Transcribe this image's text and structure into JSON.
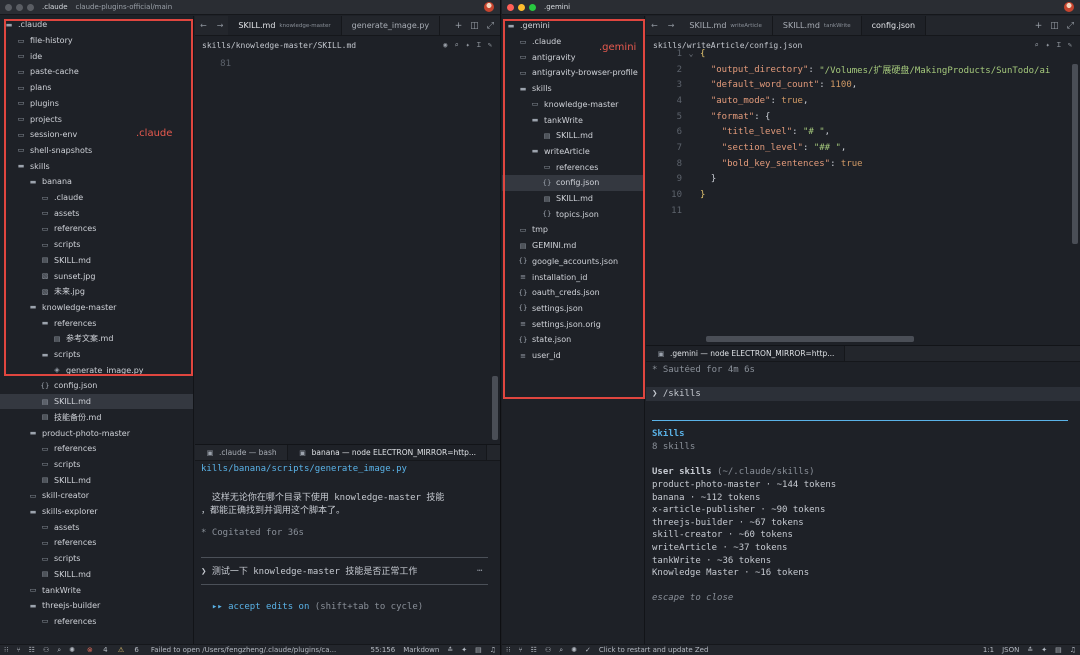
{
  "left": {
    "title": ".claude",
    "subtitle": "claude-plugins-official/main",
    "annotation_label": ".claude",
    "tree": [
      {
        "label": ".claude",
        "icon": "folder-open-icon",
        "indent": 0
      },
      {
        "label": "file-history",
        "icon": "folder-icon",
        "indent": 1
      },
      {
        "label": "ide",
        "icon": "folder-icon",
        "indent": 1
      },
      {
        "label": "paste-cache",
        "icon": "folder-icon",
        "indent": 1
      },
      {
        "label": "plans",
        "icon": "folder-icon",
        "indent": 1
      },
      {
        "label": "plugins",
        "icon": "folder-icon",
        "indent": 1
      },
      {
        "label": "projects",
        "icon": "folder-icon",
        "indent": 1
      },
      {
        "label": "session-env",
        "icon": "folder-icon",
        "indent": 1
      },
      {
        "label": "shell-snapshots",
        "icon": "folder-icon",
        "indent": 1
      },
      {
        "label": "skills",
        "icon": "folder-open-icon",
        "indent": 1
      },
      {
        "label": "banana",
        "icon": "folder-open-icon",
        "indent": 2
      },
      {
        "label": ".claude",
        "icon": "folder-icon",
        "indent": 3
      },
      {
        "label": "assets",
        "icon": "folder-icon",
        "indent": 3
      },
      {
        "label": "references",
        "icon": "folder-icon",
        "indent": 3
      },
      {
        "label": "scripts",
        "icon": "folder-icon",
        "indent": 3
      },
      {
        "label": "SKILL.md",
        "icon": "markdown-file-icon",
        "indent": 3
      },
      {
        "label": "sunset.jpg",
        "icon": "image-file-icon",
        "indent": 3
      },
      {
        "label": "未来.jpg",
        "icon": "image-file-icon",
        "indent": 3
      },
      {
        "label": "knowledge-master",
        "icon": "folder-open-icon",
        "indent": 2
      },
      {
        "label": "references",
        "icon": "folder-open-icon",
        "indent": 3
      },
      {
        "label": "参考文案.md",
        "icon": "markdown-file-icon",
        "indent": 4
      },
      {
        "label": "scripts",
        "icon": "folder-open-icon",
        "indent": 3
      },
      {
        "label": "generate_image.py",
        "icon": "python-file-icon",
        "indent": 4
      },
      {
        "label": "config.json",
        "icon": "json-file-icon",
        "indent": 3
      },
      {
        "label": "SKILL.md",
        "icon": "markdown-file-icon",
        "indent": 3,
        "selected": true
      },
      {
        "label": "技能备份.md",
        "icon": "markdown-file-icon",
        "indent": 3
      },
      {
        "label": "product-photo-master",
        "icon": "folder-open-icon",
        "indent": 2
      },
      {
        "label": "references",
        "icon": "folder-icon",
        "indent": 3
      },
      {
        "label": "scripts",
        "icon": "folder-icon",
        "indent": 3
      },
      {
        "label": "SKILL.md",
        "icon": "markdown-file-icon",
        "indent": 3
      },
      {
        "label": "skill-creator",
        "icon": "folder-icon",
        "indent": 2
      },
      {
        "label": "skills-explorer",
        "icon": "folder-open-icon",
        "indent": 2
      },
      {
        "label": "assets",
        "icon": "folder-icon",
        "indent": 3
      },
      {
        "label": "references",
        "icon": "folder-icon",
        "indent": 3
      },
      {
        "label": "scripts",
        "icon": "folder-icon",
        "indent": 3
      },
      {
        "label": "SKILL.md",
        "icon": "markdown-file-icon",
        "indent": 3
      },
      {
        "label": "tankWrite",
        "icon": "folder-icon",
        "indent": 2
      },
      {
        "label": "threejs-builder",
        "icon": "folder-open-icon",
        "indent": 2
      },
      {
        "label": "references",
        "icon": "folder-icon",
        "indent": 3
      }
    ],
    "tabs": [
      {
        "label": "SKILL.md",
        "sub": "knowledge-master",
        "active": true
      },
      {
        "label": "generate_image.py",
        "sub": "",
        "active": false
      }
    ],
    "breadcrumb": "skills/knowledge-master/SKILL.md",
    "code_line_number": "81",
    "panel_tabs": [
      {
        "label": ".claude — bash",
        "active": false
      },
      {
        "label": "banana — node ELECTRON_MIRROR=http...",
        "active": true
      }
    ],
    "terminal": {
      "path": "kills/banana/scripts/generate_image.py",
      "para1": "  这样无论你在哪个目录下使用 knowledge-master 技能",
      "para2": "，都能正确找到并调用这个脚本了。",
      "cogitated": "* Cogitated for 36s",
      "prompt": "❯ 测试一下 knowledge-master 技能是否正常工作",
      "prompt_ellipsis": "…",
      "accept_prefix": "  ▸▸ ",
      "accept_label": "accept edits on",
      "accept_hint": " (shift+tab to cycle)"
    },
    "status": {
      "errors": "4",
      "warnings": "6",
      "message": "Failed to open /Users/fengzheng/.claude/plugins/ca...",
      "position": "55:156",
      "language": "Markdown"
    }
  },
  "right": {
    "title": ".gemini",
    "annotation_label": ".gemini",
    "tree": [
      {
        "label": ".gemini",
        "icon": "folder-open-icon",
        "indent": 0
      },
      {
        "label": ".claude",
        "icon": "folder-icon",
        "indent": 1
      },
      {
        "label": "antigravity",
        "icon": "folder-icon",
        "indent": 1
      },
      {
        "label": "antigravity-browser-profile",
        "icon": "folder-icon",
        "indent": 1
      },
      {
        "label": "skills",
        "icon": "folder-open-icon",
        "indent": 1
      },
      {
        "label": "knowledge-master",
        "icon": "folder-icon",
        "indent": 2
      },
      {
        "label": "tankWrite",
        "icon": "folder-open-icon",
        "indent": 2
      },
      {
        "label": "SKILL.md",
        "icon": "markdown-file-icon",
        "indent": 3
      },
      {
        "label": "writeArticle",
        "icon": "folder-open-icon",
        "indent": 2
      },
      {
        "label": "references",
        "icon": "folder-icon",
        "indent": 3
      },
      {
        "label": "config.json",
        "icon": "json-file-icon",
        "indent": 3,
        "selected": true
      },
      {
        "label": "SKILL.md",
        "icon": "markdown-file-icon",
        "indent": 3
      },
      {
        "label": "topics.json",
        "icon": "json-file-icon",
        "indent": 3
      },
      {
        "label": "tmp",
        "icon": "folder-icon",
        "indent": 1
      },
      {
        "label": "GEMINI.md",
        "icon": "markdown-file-icon",
        "indent": 1
      },
      {
        "label": "google_accounts.json",
        "icon": "json-file-icon",
        "indent": 1
      },
      {
        "label": "installation_id",
        "icon": "text-file-icon",
        "indent": 1
      },
      {
        "label": "oauth_creds.json",
        "icon": "json-file-icon",
        "indent": 1
      },
      {
        "label": "settings.json",
        "icon": "json-file-icon",
        "indent": 1
      },
      {
        "label": "settings.json.orig",
        "icon": "text-file-icon",
        "indent": 1
      },
      {
        "label": "state.json",
        "icon": "json-file-icon",
        "indent": 1
      },
      {
        "label": "user_id",
        "icon": "text-file-icon",
        "indent": 1
      }
    ],
    "tabs": [
      {
        "label": "SKILL.md",
        "sub": "writeArticle",
        "active": false
      },
      {
        "label": "SKILL.md",
        "sub": "tankWrite",
        "active": false
      },
      {
        "label": "config.json",
        "sub": "",
        "active": true
      }
    ],
    "breadcrumb": "skills/writeArticle/config.json",
    "code": [
      {
        "n": "1",
        "fold": "⌄",
        "text": [
          {
            "c": "br",
            "t": "{"
          }
        ]
      },
      {
        "n": "2",
        "text": [
          {
            "c": "p",
            "t": "  "
          },
          {
            "c": "k",
            "t": "\"output_directory\""
          },
          {
            "c": "p",
            "t": ": "
          },
          {
            "c": "s",
            "t": "\"/Volumes/扩展硬盘/MakingProducts/SunTodo/ai"
          }
        ]
      },
      {
        "n": "3",
        "text": [
          {
            "c": "p",
            "t": "  "
          },
          {
            "c": "k",
            "t": "\"default_word_count\""
          },
          {
            "c": "p",
            "t": ": "
          },
          {
            "c": "n",
            "t": "1100"
          },
          {
            "c": "p",
            "t": ","
          }
        ]
      },
      {
        "n": "4",
        "text": [
          {
            "c": "p",
            "t": "  "
          },
          {
            "c": "k",
            "t": "\"auto_mode\""
          },
          {
            "c": "p",
            "t": ": "
          },
          {
            "c": "b",
            "t": "true"
          },
          {
            "c": "p",
            "t": ","
          }
        ]
      },
      {
        "n": "5",
        "text": [
          {
            "c": "p",
            "t": "  "
          },
          {
            "c": "k",
            "t": "\"format\""
          },
          {
            "c": "p",
            "t": ": {"
          }
        ]
      },
      {
        "n": "6",
        "text": [
          {
            "c": "p",
            "t": "    "
          },
          {
            "c": "k",
            "t": "\"title_level\""
          },
          {
            "c": "p",
            "t": ": "
          },
          {
            "c": "s",
            "t": "\"# \""
          },
          {
            "c": "p",
            "t": ","
          }
        ]
      },
      {
        "n": "7",
        "text": [
          {
            "c": "p",
            "t": "    "
          },
          {
            "c": "k",
            "t": "\"section_level\""
          },
          {
            "c": "p",
            "t": ": "
          },
          {
            "c": "s",
            "t": "\"## \""
          },
          {
            "c": "p",
            "t": ","
          }
        ]
      },
      {
        "n": "8",
        "text": [
          {
            "c": "p",
            "t": "    "
          },
          {
            "c": "k",
            "t": "\"bold_key_sentences\""
          },
          {
            "c": "p",
            "t": ": "
          },
          {
            "c": "b",
            "t": "true"
          }
        ]
      },
      {
        "n": "9",
        "text": [
          {
            "c": "p",
            "t": "  }"
          }
        ]
      },
      {
        "n": "10",
        "text": [
          {
            "c": "br",
            "t": "}"
          }
        ]
      },
      {
        "n": "11",
        "text": []
      }
    ],
    "panel_tabs": [
      {
        "label": ".gemini — node ELECTRON_MIRROR=http...",
        "active": true
      }
    ],
    "terminal": {
      "sauteed": "* Sautéed for 4m 6s",
      "command": "❯ /skills",
      "skills_title": "Skills",
      "skills_count": "8 skills",
      "user_skills_label": "User skills",
      "user_skills_path": " (~/.claude/skills)",
      "skills": [
        "product-photo-master · ~144 tokens",
        "banana · ~112 tokens",
        "x-article-publisher · ~90 tokens",
        "threejs-builder · ~67 tokens",
        "skill-creator · ~60 tokens",
        "writeArticle · ~37 tokens",
        "tankWrite · ~36 tokens",
        "Knowledge Master · ~16 tokens"
      ],
      "escape": "escape to close"
    },
    "status": {
      "message": "Click to restart and update Zed",
      "position": "1:1",
      "language": "JSON"
    }
  }
}
